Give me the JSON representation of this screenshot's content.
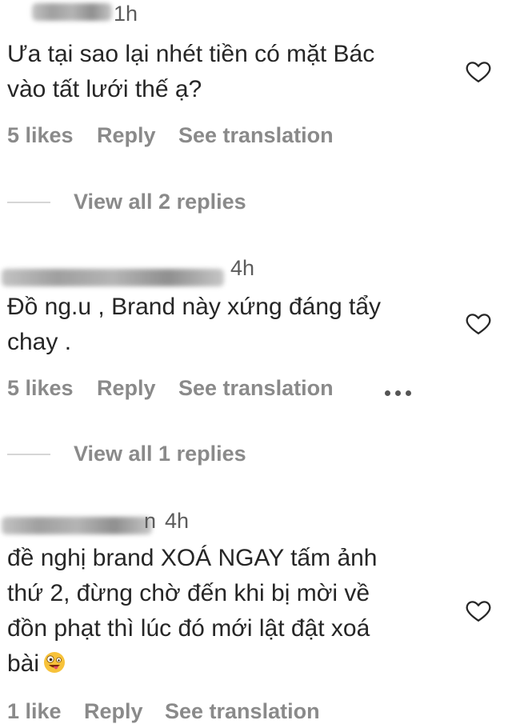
{
  "comments": [
    {
      "time": "1h",
      "text_lines": [
        "Ưa tại sao lại nhét tiền có mặt Bác",
        "vào tất lưới thế ạ?"
      ],
      "likes": "5 likes",
      "reply": "Reply",
      "translate": "See translation",
      "view_replies": "View all 2 replies"
    },
    {
      "time": "4h",
      "text_lines": [
        "Đồ ng.u , Brand này xứng đáng tẩy",
        "chay ."
      ],
      "likes": "5 likes",
      "reply": "Reply",
      "translate": "See translation",
      "view_replies": "View all 1 replies"
    },
    {
      "time": "4h",
      "username_tail": "n",
      "text_lines": [
        "đề nghị brand XOÁ NGAY tấm ảnh",
        "thứ 2, đừng chờ đến khi bị mời về",
        "đồn phạt thì lúc đó mới lật đật xoá",
        "bài"
      ],
      "likes": "1 like",
      "reply": "Reply",
      "translate": "See translation"
    }
  ],
  "icons": {
    "like": "heart-outline-icon",
    "more": "more-horizontal-icon",
    "emoji": "zany-face-emoji"
  }
}
